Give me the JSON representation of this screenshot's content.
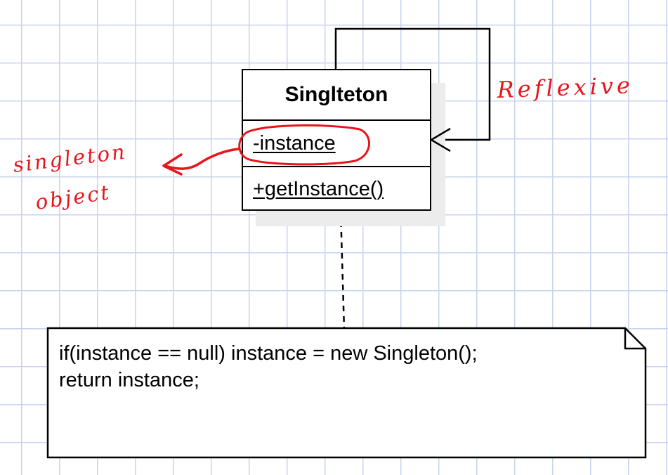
{
  "uml_class": {
    "name": "Singlteton",
    "attribute": "-instance",
    "operation": "+getInstance()"
  },
  "note": {
    "line1": "if(instance == null) instance = new Singleton();",
    "line2": "return instance;"
  },
  "annotations": {
    "reflexive": "Reflexive",
    "singleton_object": [
      "singleton",
      "object"
    ],
    "ink_color": "#e8141a"
  }
}
